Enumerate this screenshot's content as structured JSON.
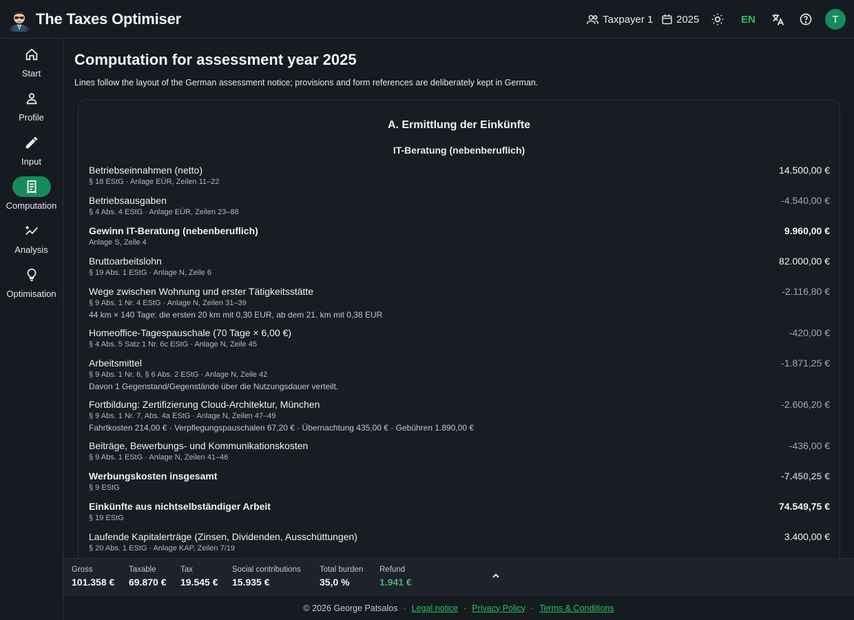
{
  "app": {
    "title": "The Taxes Optimiser"
  },
  "header": {
    "taxpayer_label": "Taxpayer 1",
    "year_label": "2025",
    "language_label": "EN",
    "avatar_initial": "T"
  },
  "sidebar": {
    "items": [
      {
        "label": "Start",
        "icon": "home-icon"
      },
      {
        "label": "Profile",
        "icon": "person-icon"
      },
      {
        "label": "Input",
        "icon": "pencil-icon"
      },
      {
        "label": "Computation",
        "icon": "receipt-icon"
      },
      {
        "label": "Analysis",
        "icon": "trend-icon"
      },
      {
        "label": "Optimisation",
        "icon": "lightbulb-icon"
      }
    ],
    "active": "Computation"
  },
  "page": {
    "title": "Computation for assessment year 2025",
    "subtitle": "Lines follow the layout of the German assessment notice; provisions and form references are deliberately kept in German."
  },
  "computation": {
    "section_title": "A. Ermittlung der Einkünfte",
    "group_title": "IT-Beratung (nebenberuflich)",
    "rows": [
      {
        "label": "Betriebseinnahmen (netto)",
        "ref": "§ 18 EStG · Anlage EÜR, Zeilen 11–22",
        "note": "",
        "amount": "14.500,00 €"
      },
      {
        "label": "Betriebsausgaben",
        "ref": "§ 4 Abs. 4 EStG · Anlage EÜR, Zeilen 23–88",
        "note": "",
        "amount": "-4.540,00 €"
      },
      {
        "label": "Gewinn IT-Beratung (nebenberuflich)",
        "ref": "Anlage S, Zeile 4",
        "note": "",
        "amount": "9.960,00 €"
      },
      {
        "label": "Bruttoarbeitslohn",
        "ref": "§ 19 Abs. 1 EStG · Anlage N, Zeile 6",
        "note": "",
        "amount": "82.000,00 €"
      },
      {
        "label": "Wege zwischen Wohnung und erster Tätigkeitsstätte",
        "ref": "§ 9 Abs. 1 Nr. 4 EStG · Anlage N, Zeilen 31–39",
        "note": "44 km × 140 Tage: die ersten 20 km mit 0,30 EUR, ab dem 21. km mit 0,38 EUR",
        "amount": "-2.116,80 €"
      },
      {
        "label": "Homeoffice-Tagespauschale (70 Tage × 6,00 €)",
        "ref": "§ 4 Abs. 5 Satz 1 Nr. 6c EStG · Anlage N, Zeile 45",
        "note": "",
        "amount": "-420,00 €"
      },
      {
        "label": "Arbeitsmittel",
        "ref": "§ 9 Abs. 1 Nr. 6, § 6 Abs. 2 EStG · Anlage N, Zeile 42",
        "note": "Davon 1 Gegenstand/Gegenstände über die Nutzungsdauer verteilt.",
        "amount": "-1.871,25 €"
      },
      {
        "label": "Fortbildung: Zertifizierung Cloud-Architektur, München",
        "ref": "§ 9 Abs. 1 Nr. 7, Abs. 4a EStG · Anlage N, Zeilen 47–49",
        "note": "Fahrtkosten 214,00 € · Verpflegungspauschalen 67,20 € · Übernachtung 435,00 € · Gebühren 1.890,00 €",
        "amount": "-2.606,20 €"
      },
      {
        "label": "Beiträge, Bewerbungs- und Kommunikationskosten",
        "ref": "§ 9 Abs. 1 EStG · Anlage N, Zeilen 41–46",
        "note": "",
        "amount": "-436,00 €"
      },
      {
        "label": "Werbungskosten insgesamt",
        "ref": "§ 9 EStG",
        "note": "",
        "amount": "-7.450,25 €"
      },
      {
        "label": "Einkünfte aus nichtselbständiger Arbeit",
        "ref": "§ 19 EStG",
        "note": "",
        "amount": "74.549,75 €"
      },
      {
        "label": "Laufende Kapitalerträge (Zinsen, Dividenden, Ausschüttungen)",
        "ref": "§ 20 Abs. 1 EStG · Anlage KAP, Zeilen 7/19",
        "note": "",
        "amount": "3.400,00 €"
      }
    ]
  },
  "summary": {
    "gross": {
      "label": "Gross",
      "value": "101.358 €"
    },
    "taxable": {
      "label": "Taxable",
      "value": "69.870 €"
    },
    "tax": {
      "label": "Tax",
      "value": "19.545 €"
    },
    "social": {
      "label": "Social contributions",
      "value": "15.935 €"
    },
    "burden": {
      "label": "Total burden",
      "value": "35,0 %"
    },
    "refund": {
      "label": "Refund",
      "value": "1.941 €"
    }
  },
  "footer": {
    "copyright": "© 2026 George Patsalos",
    "separator": "·",
    "legal": "Legal notice",
    "privacy": "Privacy Policy",
    "terms": "Terms & Conditions"
  },
  "colors": {
    "accent": "#178a5b",
    "accent_text": "#22c55e",
    "refund": "#4caf73",
    "background": "#161a21"
  }
}
